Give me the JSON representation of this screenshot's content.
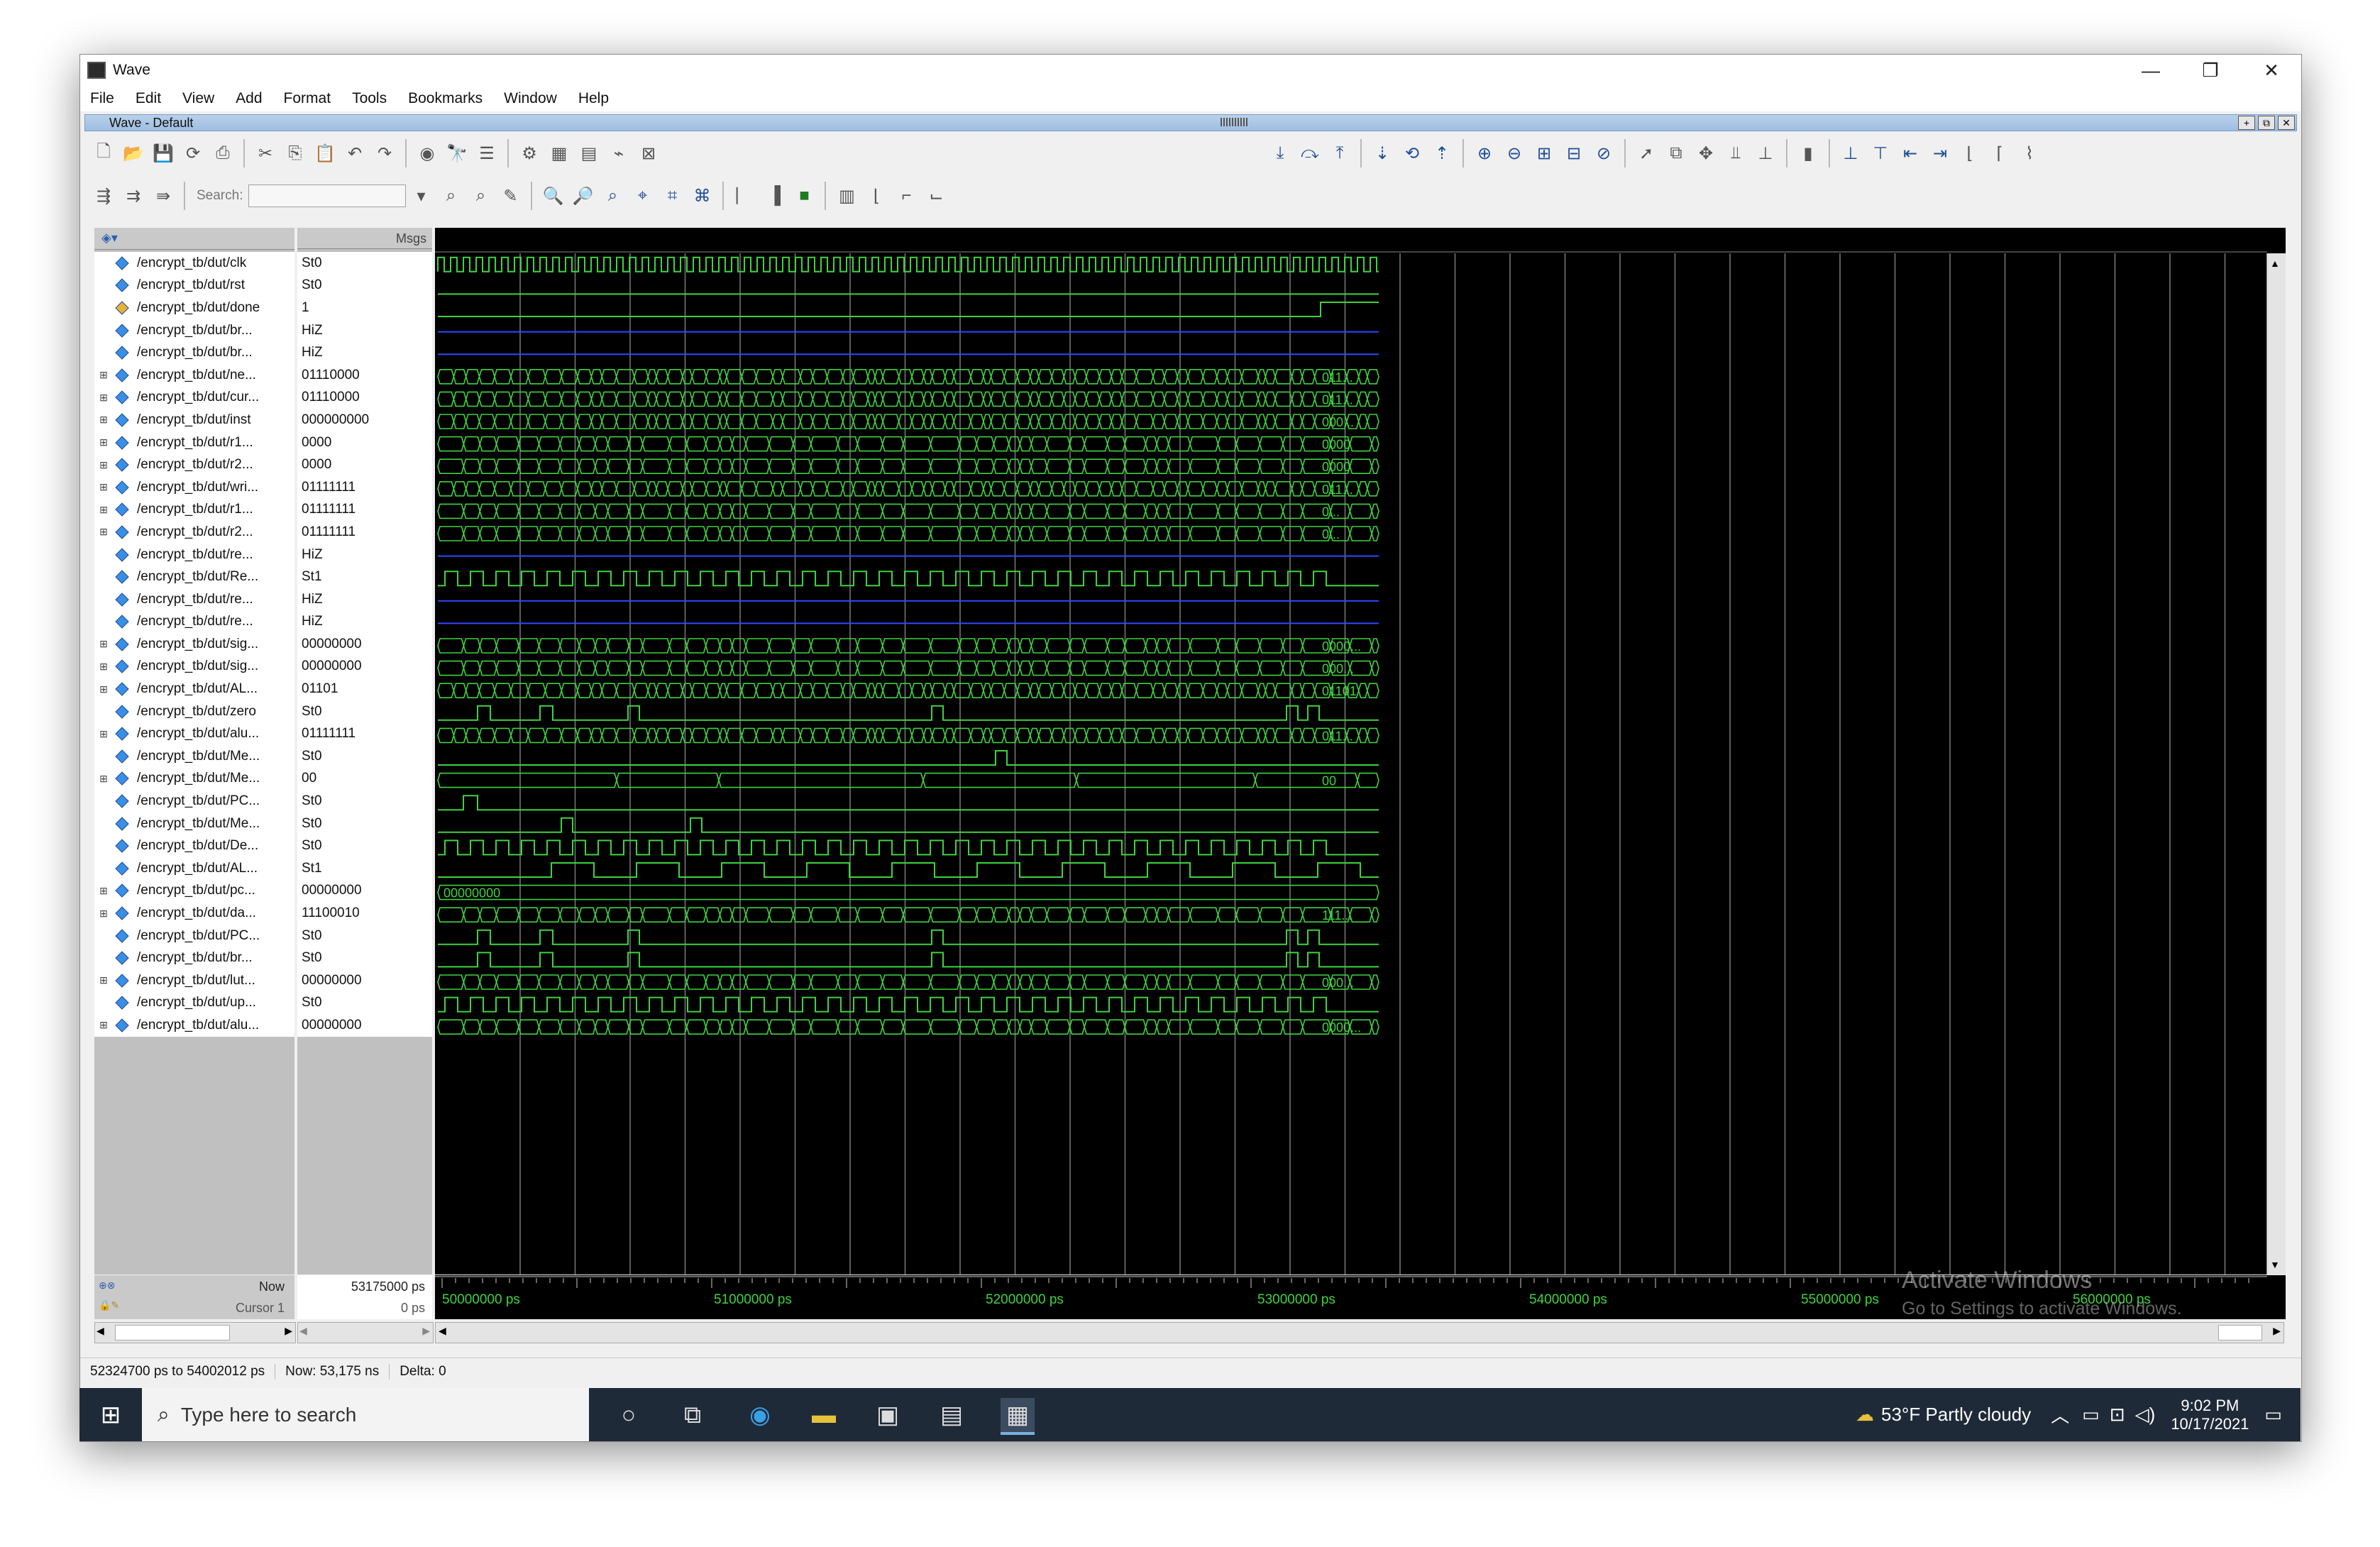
{
  "window": {
    "title": "Wave",
    "subwindow_title": "Wave - Default",
    "minimize": "—",
    "restore": "❐",
    "close": "✕"
  },
  "menu": [
    "File",
    "Edit",
    "View",
    "Add",
    "Format",
    "Tools",
    "Bookmarks",
    "Window",
    "Help"
  ],
  "toolbar": {
    "search_label": "Search:",
    "search_value": ""
  },
  "headers": {
    "name": "",
    "msgs": "Msgs"
  },
  "signals": [
    {
      "name": "/encrypt_tb/dut/clk",
      "value": "St0",
      "expand": false,
      "color": "#3a8ee6",
      "wave": "clock"
    },
    {
      "name": "/encrypt_tb/dut/rst",
      "value": "St0",
      "expand": false,
      "color": "#3a8ee6",
      "wave": "low"
    },
    {
      "name": "/encrypt_tb/dut/done",
      "value": "1",
      "expand": false,
      "color": "#e6b13a",
      "wave": "done"
    },
    {
      "name": "/encrypt_tb/dut/br...",
      "value": "HiZ",
      "expand": false,
      "color": "#3a8ee6",
      "wave": "hiz"
    },
    {
      "name": "/encrypt_tb/dut/br...",
      "value": "HiZ",
      "expand": false,
      "color": "#3a8ee6",
      "wave": "hiz"
    },
    {
      "name": "/encrypt_tb/dut/ne...",
      "value": "01110000",
      "expand": true,
      "color": "#3a8ee6",
      "wave": "busdense",
      "label": "011..."
    },
    {
      "name": "/encrypt_tb/dut/cur...",
      "value": "01110000",
      "expand": true,
      "color": "#3a8ee6",
      "wave": "busdense",
      "label": "011..."
    },
    {
      "name": "/encrypt_tb/dut/inst",
      "value": "000000000",
      "expand": true,
      "color": "#3a8ee6",
      "wave": "busdense",
      "label": "000..."
    },
    {
      "name": "/encrypt_tb/dut/r1...",
      "value": "0000",
      "expand": true,
      "color": "#3a8ee6",
      "wave": "busmed",
      "label": "0000"
    },
    {
      "name": "/encrypt_tb/dut/r2...",
      "value": "0000",
      "expand": true,
      "color": "#3a8ee6",
      "wave": "busmed",
      "label": "0000"
    },
    {
      "name": "/encrypt_tb/dut/wri...",
      "value": "01111111",
      "expand": true,
      "color": "#3a8ee6",
      "wave": "busdense",
      "label": "011..."
    },
    {
      "name": "/encrypt_tb/dut/r1...",
      "value": "01111111",
      "expand": true,
      "color": "#3a8ee6",
      "wave": "busmed",
      "label": "0..."
    },
    {
      "name": "/encrypt_tb/dut/r2...",
      "value": "01111111",
      "expand": true,
      "color": "#3a8ee6",
      "wave": "busmed",
      "label": "0..."
    },
    {
      "name": "/encrypt_tb/dut/re...",
      "value": "HiZ",
      "expand": false,
      "color": "#3a8ee6",
      "wave": "hiz"
    },
    {
      "name": "/encrypt_tb/dut/Re...",
      "value": "St1",
      "expand": false,
      "color": "#3a8ee6",
      "wave": "pulses"
    },
    {
      "name": "/encrypt_tb/dut/re...",
      "value": "HiZ",
      "expand": false,
      "color": "#3a8ee6",
      "wave": "hiz"
    },
    {
      "name": "/encrypt_tb/dut/re...",
      "value": "HiZ",
      "expand": false,
      "color": "#3a8ee6",
      "wave": "hiz"
    },
    {
      "name": "/encrypt_tb/dut/sig...",
      "value": "00000000",
      "expand": true,
      "color": "#3a8ee6",
      "wave": "busmed",
      "label": "0000..."
    },
    {
      "name": "/encrypt_tb/dut/sig...",
      "value": "00000000",
      "expand": true,
      "color": "#3a8ee6",
      "wave": "busmed",
      "label": "000..."
    },
    {
      "name": "/encrypt_tb/dut/AL...",
      "value": "01101",
      "expand": true,
      "color": "#3a8ee6",
      "wave": "busdense",
      "label": "01101"
    },
    {
      "name": "/encrypt_tb/dut/zero",
      "value": "St0",
      "expand": false,
      "color": "#3a8ee6",
      "wave": "sparse"
    },
    {
      "name": "/encrypt_tb/dut/alu...",
      "value": "01111111",
      "expand": true,
      "color": "#3a8ee6",
      "wave": "busdense",
      "label": "011..."
    },
    {
      "name": "/encrypt_tb/dut/Me...",
      "value": "St0",
      "expand": false,
      "color": "#3a8ee6",
      "wave": "single"
    },
    {
      "name": "/encrypt_tb/dut/Me...",
      "value": "00",
      "expand": true,
      "color": "#3a8ee6",
      "wave": "bussparse",
      "label": "00"
    },
    {
      "name": "/encrypt_tb/dut/PC...",
      "value": "St0",
      "expand": false,
      "color": "#3a8ee6",
      "wave": "early"
    },
    {
      "name": "/encrypt_tb/dut/Me...",
      "value": "St0",
      "expand": false,
      "color": "#3a8ee6",
      "wave": "twopulse"
    },
    {
      "name": "/encrypt_tb/dut/De...",
      "value": "St0",
      "expand": false,
      "color": "#3a8ee6",
      "wave": "pulses"
    },
    {
      "name": "/encrypt_tb/dut/AL...",
      "value": "St1",
      "expand": false,
      "color": "#3a8ee6",
      "wave": "slow"
    },
    {
      "name": "/encrypt_tb/dut/pc...",
      "value": "00000000",
      "expand": true,
      "color": "#3a8ee6",
      "wave": "busconst",
      "label": "00000000"
    },
    {
      "name": "/encrypt_tb/dut/da...",
      "value": "11100010",
      "expand": true,
      "color": "#3a8ee6",
      "wave": "busmed",
      "label": "111..."
    },
    {
      "name": "/encrypt_tb/dut/PC...",
      "value": "St0",
      "expand": false,
      "color": "#3a8ee6",
      "wave": "sparse"
    },
    {
      "name": "/encrypt_tb/dut/br...",
      "value": "St0",
      "expand": false,
      "color": "#3a8ee6",
      "wave": "sparse"
    },
    {
      "name": "/encrypt_tb/dut/lut...",
      "value": "00000000",
      "expand": true,
      "color": "#3a8ee6",
      "wave": "busmed",
      "label": "000..."
    },
    {
      "name": "/encrypt_tb/dut/up...",
      "value": "St0",
      "expand": false,
      "color": "#3a8ee6",
      "wave": "pulses"
    },
    {
      "name": "/encrypt_tb/dut/alu...",
      "value": "00000000",
      "expand": true,
      "color": "#3a8ee6",
      "wave": "busmed",
      "label": "0000..."
    }
  ],
  "cursor_panel": {
    "now_label": "Now",
    "now_value": "53175000 ps",
    "cursor_label": "Cursor 1",
    "cursor_value": "0 ps"
  },
  "timeline": {
    "ticks": [
      "50000000 ps",
      "51000000 ps",
      "52000000 ps",
      "53000000 ps",
      "54000000 ps",
      "55000000 ps",
      "56000000 ps"
    ]
  },
  "status": {
    "range": "52324700 ps to 54002012 ps",
    "now": "Now: 53,175 ns",
    "delta": "Delta: 0"
  },
  "watermark": {
    "line1": "Activate Windows",
    "line2": "Go to Settings to activate Windows."
  },
  "taskbar": {
    "search_placeholder": "Type here to search",
    "weather": "53°F  Partly cloudy",
    "time": "9:02 PM",
    "date": "10/17/2021"
  },
  "colors": {
    "wave_green": "#3fd23f",
    "hiz_blue": "#2f48ff",
    "background": "#000000"
  }
}
